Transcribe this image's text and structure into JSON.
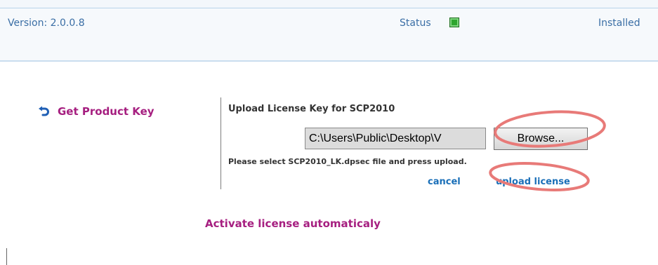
{
  "info_bar": {
    "version": "Version: 2.0.0.8",
    "status_label": "Status",
    "installed_label": "Installed"
  },
  "get_key": {
    "label": "Get Product Key",
    "icon": "undo-arrow-icon"
  },
  "upload": {
    "title": "Upload License Key for SCP2010",
    "file_path_value": "C:\\Users\\Public\\Desktop\\V",
    "browse_label": "Browse...",
    "hint": "Please select SCP2010_LK.dpsec file and press upload.",
    "cancel_label": "cancel",
    "upload_label": "upload license"
  },
  "activate": {
    "label": "Activate license automaticaly"
  },
  "colors": {
    "accent_magenta": "#a61f80",
    "link_blue": "#1a6fb8",
    "version_blue": "#3a6ea5",
    "status_green": "#2ea52e",
    "annotation_red": "#e87a78"
  }
}
